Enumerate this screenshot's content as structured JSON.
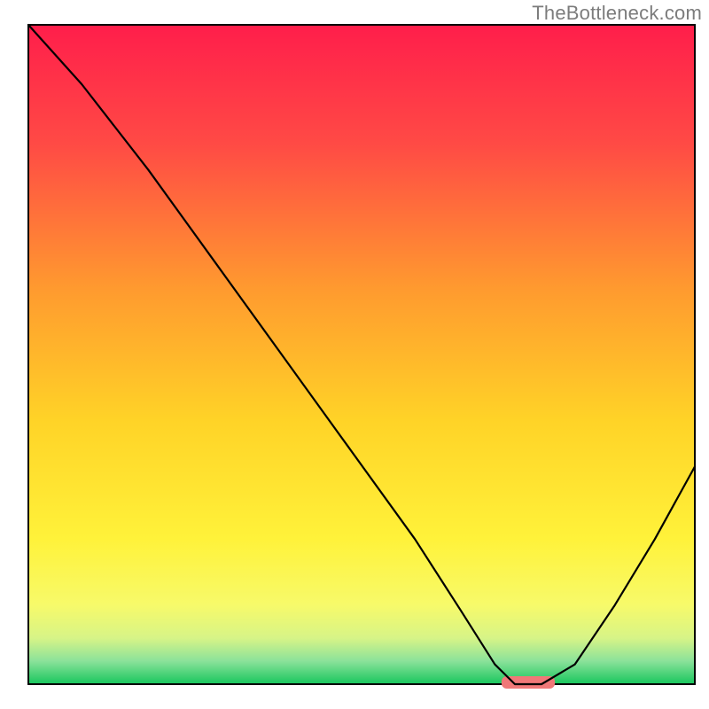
{
  "watermark": "TheBottleneck.com",
  "chart_data": {
    "type": "line",
    "title": "",
    "xlabel": "",
    "ylabel": "",
    "xlim": [
      0,
      100
    ],
    "ylim": [
      0,
      100
    ],
    "grid": false,
    "legend": false,
    "series": [
      {
        "name": "curve",
        "x": [
          0,
          8,
          18,
          28,
          38,
          48,
          58,
          65,
          70,
          73,
          77,
          82,
          88,
          94,
          100
        ],
        "y": [
          100,
          91,
          78,
          64,
          50,
          36,
          22,
          11,
          3,
          0,
          0,
          3,
          12,
          22,
          33
        ]
      }
    ],
    "marker": {
      "name": "optimal-range-marker",
      "x_start": 71,
      "x_end": 79,
      "y": 0,
      "color": "#f07878"
    },
    "background_gradient": {
      "stops": [
        {
          "pos": 0.0,
          "color": "#ff1e4b"
        },
        {
          "pos": 0.18,
          "color": "#ff4a45"
        },
        {
          "pos": 0.4,
          "color": "#ff9a2f"
        },
        {
          "pos": 0.6,
          "color": "#ffd327"
        },
        {
          "pos": 0.78,
          "color": "#fff23a"
        },
        {
          "pos": 0.88,
          "color": "#f7fa6a"
        },
        {
          "pos": 0.93,
          "color": "#d7f487"
        },
        {
          "pos": 0.965,
          "color": "#8be29a"
        },
        {
          "pos": 1.0,
          "color": "#18c65d"
        }
      ]
    },
    "border_color": "#000000"
  }
}
